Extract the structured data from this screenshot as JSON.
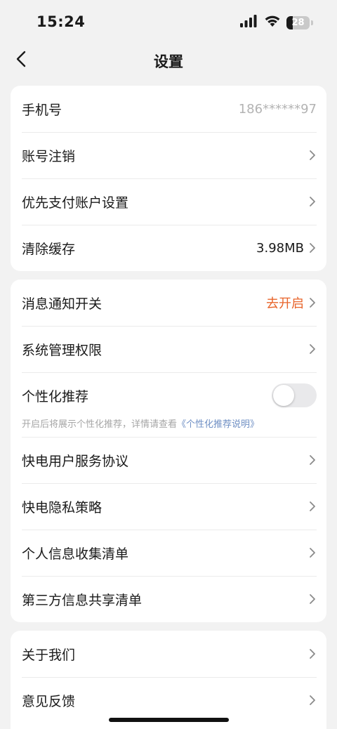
{
  "status_bar": {
    "time": "15:24",
    "battery_level": "28",
    "battery_fraction": 0.28,
    "icons": [
      "signal-icon",
      "wifi-icon",
      "battery-icon"
    ]
  },
  "nav": {
    "title": "设置",
    "back_icon": "chevron-left-icon"
  },
  "colors": {
    "background": "#f2f2f2",
    "card": "#ffffff",
    "accent_orange": "#e8642a",
    "link_blue": "#6f8fc4",
    "muted_text": "#b3b3b3"
  },
  "group1": {
    "phone": {
      "label": "手机号",
      "value": "186******97"
    },
    "account_cancel": {
      "label": "账号注销"
    },
    "payment_settings": {
      "label": "优先支付账户设置"
    },
    "clear_cache": {
      "label": "清除缓存",
      "value": "3.98MB"
    }
  },
  "group2": {
    "notifications": {
      "label": "消息通知开关",
      "value": "去开启"
    },
    "system_permissions": {
      "label": "系统管理权限"
    },
    "personalized": {
      "label": "个性化推荐",
      "enabled": false,
      "hint_prefix": "开启后将展示个性化推荐，详情请查看",
      "hint_link": "《个性化推荐说明》"
    },
    "service_agreement": {
      "label": "快电用户服务协议"
    },
    "privacy_policy": {
      "label": "快电隐私策略"
    },
    "personal_info_list": {
      "label": "个人信息收集清单"
    },
    "third_party_list": {
      "label": "第三方信息共享清单"
    }
  },
  "group3": {
    "about": {
      "label": "关于我们"
    },
    "feedback": {
      "label": "意见反馈"
    }
  }
}
